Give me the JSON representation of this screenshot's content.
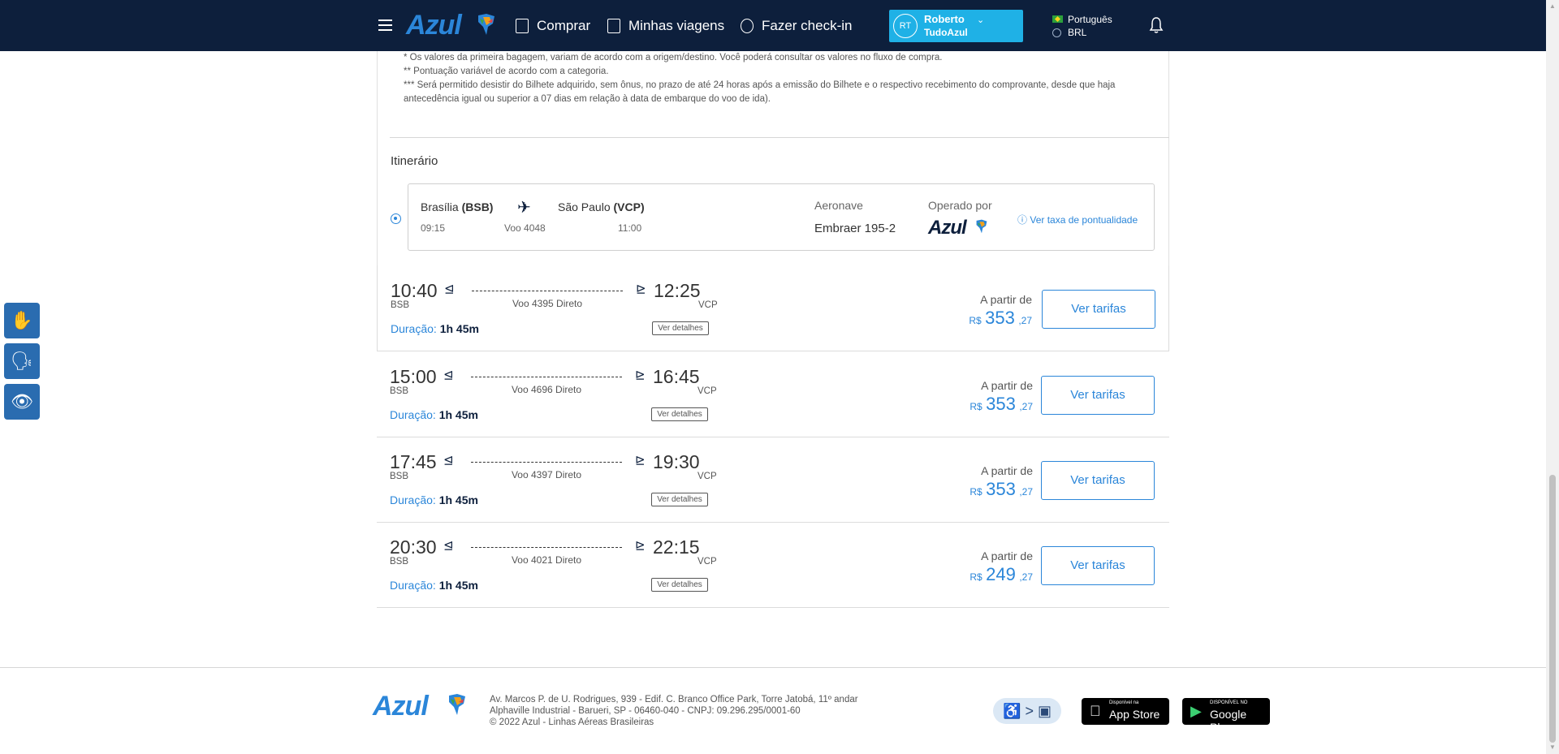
{
  "header": {
    "logo": "Azul",
    "nav": [
      {
        "label": "Comprar"
      },
      {
        "label": "Minhas viagens"
      },
      {
        "label": "Fazer check-in"
      }
    ],
    "user": {
      "initials": "RT",
      "name": "Roberto",
      "program": "TudoAzul"
    },
    "language": "Português",
    "currency": "BRL"
  },
  "footnotes": [
    "* Os valores da primeira bagagem, variam de acordo com a origem/destino. Você poderá consultar os valores no fluxo de compra.",
    "** Pontuação variável de acordo com a categoria.",
    "*** Será permitido desistir do Bilhete adquirido, sem ônus, no prazo de até 24 horas após a emissão do Bilhete e o respectivo recebimento do comprovante, desde que haja antecedência igual ou superior a 07 dias em relação à data de embarque do voo de ida)."
  ],
  "itinerary": {
    "title": "Itinerário",
    "origin_city": "Brasília ",
    "origin_code": "(BSB)",
    "origin_time": "09:15",
    "flight": "Voo 4048",
    "dest_city": "São Paulo ",
    "dest_code": "(VCP)",
    "dest_time": "11:00",
    "aircraft_label": "Aeronave",
    "aircraft_value": "Embraer 195-2",
    "operated_label": "Operado por",
    "operated_value": "Azul",
    "punctuality_link": "Ver taxa de pontualidade"
  },
  "flights": [
    {
      "dep": "10:40",
      "dep_code": "BSB",
      "flight": "Voo 4395 Direto",
      "arr": "12:25",
      "arr_code": "VCP",
      "duration_label": "Duração: ",
      "duration": "1h 45m",
      "details": "Ver detalhes",
      "from": "A partir de",
      "currency": "R$",
      "price_int": "353",
      "price_cents": ",27",
      "button": "Ver tarifas"
    },
    {
      "dep": "15:00",
      "dep_code": "BSB",
      "flight": "Voo 4696 Direto",
      "arr": "16:45",
      "arr_code": "VCP",
      "duration_label": "Duração: ",
      "duration": "1h 45m",
      "details": "Ver detalhes",
      "from": "A partir de",
      "currency": "R$",
      "price_int": "353",
      "price_cents": ",27",
      "button": "Ver tarifas"
    },
    {
      "dep": "17:45",
      "dep_code": "BSB",
      "flight": "Voo 4397 Direto",
      "arr": "19:30",
      "arr_code": "VCP",
      "duration_label": "Duração: ",
      "duration": "1h 45m",
      "details": "Ver detalhes",
      "from": "A partir de",
      "currency": "R$",
      "price_int": "353",
      "price_cents": ",27",
      "button": "Ver tarifas"
    },
    {
      "dep": "20:30",
      "dep_code": "BSB",
      "flight": "Voo 4021 Direto",
      "arr": "22:15",
      "arr_code": "VCP",
      "duration_label": "Duração: ",
      "duration": "1h 45m",
      "details": "Ver detalhes",
      "from": "A partir de",
      "currency": "R$",
      "price_int": "249",
      "price_cents": ",27",
      "button": "Ver tarifas"
    }
  ],
  "footer": {
    "logo": "Azul",
    "address": [
      "Av. Marcos P. de U. Rodrigues, 939 - Edif. C. Branco Office Park, Torre Jatobá, 11º andar",
      "Alphaville Industrial - Barueri, SP - 06460-040 - CNPJ: 09.296.295/0001-60",
      "© 2022 Azul - Linhas Aéreas Brasileiras"
    ],
    "app_store_small": "Disponível na",
    "app_store": "App Store",
    "google_play_small": "DISPONÍVEL NO",
    "google_play": "Google Play"
  },
  "colors": {
    "navy": "#0d1f3c",
    "accent": "#2b86d9",
    "user_button": "#1fb1e6",
    "a11y": "#2a6cb0"
  }
}
